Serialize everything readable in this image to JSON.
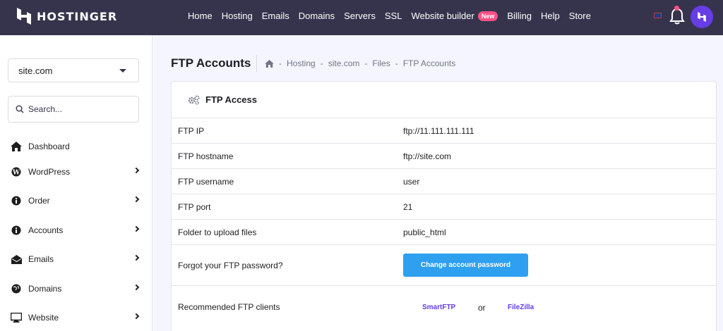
{
  "brand": {
    "name": "HOSTINGER"
  },
  "nav": {
    "items": [
      "Home",
      "Hosting",
      "Emails",
      "Domains",
      "Servers",
      "SSL",
      "Website builder",
      "Billing",
      "Help",
      "Store"
    ],
    "new_badge": "New"
  },
  "sidebar": {
    "site_select": "site.com",
    "search_placeholder": "Search...",
    "items": [
      {
        "label": "Dashboard",
        "icon": "home-icon",
        "has_chevron": false
      },
      {
        "label": "WordPress",
        "icon": "wordpress-icon",
        "has_chevron": true
      },
      {
        "label": "Order",
        "icon": "info-icon",
        "has_chevron": true
      },
      {
        "label": "Accounts",
        "icon": "info-icon",
        "has_chevron": true
      },
      {
        "label": "Emails",
        "icon": "envelope-icon",
        "has_chevron": true
      },
      {
        "label": "Domains",
        "icon": "globe-icon",
        "has_chevron": true
      },
      {
        "label": "Website",
        "icon": "monitor-icon",
        "has_chevron": true
      }
    ]
  },
  "page": {
    "title": "FTP Accounts",
    "breadcrumb": [
      "Hosting",
      "site.com",
      "Files",
      "FTP Accounts"
    ]
  },
  "ftp": {
    "header": "FTP Access",
    "rows": [
      {
        "label": "FTP IP",
        "value": "ftp://11.111.111.111"
      },
      {
        "label": "FTP hostname",
        "value": "ftp://site.com"
      },
      {
        "label": "FTP username",
        "value": "user"
      },
      {
        "label": "FTP port",
        "value": "21"
      },
      {
        "label": "Folder to upload files",
        "value": "public_html"
      }
    ],
    "forgot_label": "Forgot your FTP password?",
    "change_password_button": "Change account password",
    "clients_label": "Recommended FTP clients",
    "client_1": "SmartFTP",
    "or_text": "or",
    "client_2": "FileZilla"
  },
  "colors": {
    "topbar": "#36344d",
    "accent": "#673de6",
    "button": "#2f9ff0",
    "badge": "#fc5185"
  }
}
